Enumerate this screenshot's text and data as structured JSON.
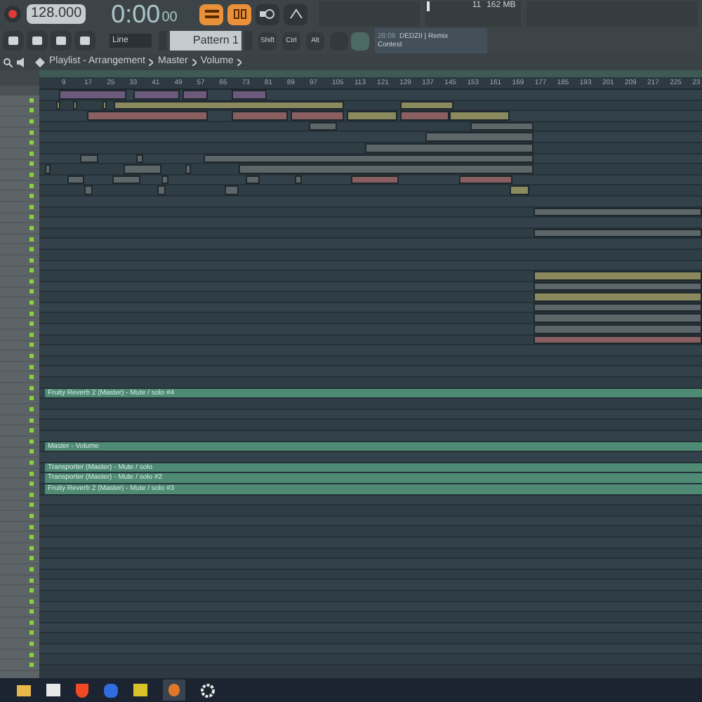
{
  "toolbar": {
    "tempo": "128.000",
    "time": "0:00",
    "time_small": "00",
    "pattern": "Pattern 1",
    "snap": "Line",
    "modifiers": [
      "Shift",
      "Ctrl",
      "Alt"
    ],
    "cpu": "11",
    "memory": "162 MB",
    "hint": {
      "time": "28:09",
      "title": "DEDZII | Remix",
      "subtitle": "Contest"
    }
  },
  "breadcrumb": {
    "items": [
      "Playlist - Arrangement",
      "Master",
      "Volume"
    ]
  },
  "ruler": [
    "9",
    "17",
    "25",
    "33",
    "41",
    "49",
    "57",
    "65",
    "73",
    "81",
    "89",
    "97",
    "105",
    "113",
    "121",
    "129",
    "137",
    "145",
    "153",
    "161",
    "169",
    "177",
    "185",
    "193",
    "201",
    "209",
    "217",
    "225",
    "23"
  ],
  "automation_clips": [
    {
      "label": "Fruity Reverb 2 (Master) - Mute / solo #4"
    },
    {
      "label": "Master - Volume"
    },
    {
      "label": "Transporter (Master) - Mute / solo"
    },
    {
      "label": "Transporter (Master) - Mute / solo #2"
    },
    {
      "label": "Fruity Reverb 2 (Master) - Mute / solo #3"
    }
  ]
}
